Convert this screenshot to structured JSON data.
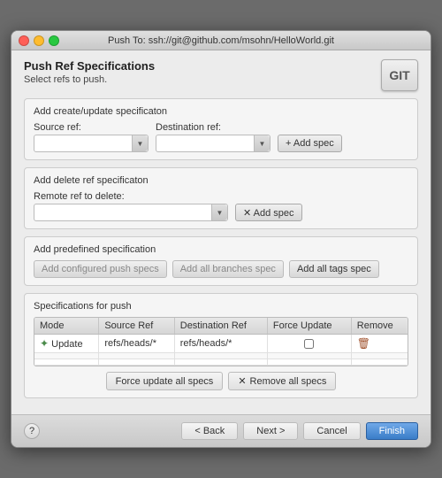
{
  "window": {
    "title": "Push To: ssh://git@github.com/msohn/HelloWorld.git"
  },
  "header": {
    "title": "Push Ref Specifications",
    "subtitle": "Select refs to push.",
    "git_label": "GIT"
  },
  "create_update_section": {
    "title": "Add create/update specificaton",
    "source_label": "Source ref:",
    "destination_label": "Destination ref:",
    "add_btn": "+ Add spec",
    "source_placeholder": "",
    "destination_placeholder": ""
  },
  "delete_section": {
    "title": "Add delete ref specificaton",
    "remote_label": "Remote ref to delete:",
    "add_btn": "✕ Add spec",
    "placeholder": ""
  },
  "predefined_section": {
    "title": "Add predefined specification",
    "btn1": "Add configured push specs",
    "btn2": "Add all branches spec",
    "btn3": "Add all tags spec"
  },
  "specs_section": {
    "title": "Specifications for push",
    "columns": [
      "Mode",
      "Source Ref",
      "Destination Ref",
      "Force Update",
      "Remove"
    ],
    "rows": [
      {
        "mode_icon": "✦",
        "mode": "Update",
        "source": "refs/heads/*",
        "destination": "refs/heads/*",
        "force_update": false,
        "remove": true
      }
    ],
    "force_update_btn": "Force update all specs",
    "remove_all_btn": "Remove all specs"
  },
  "footer": {
    "help_label": "?",
    "back_btn": "< Back",
    "next_btn": "Next >",
    "cancel_btn": "Cancel",
    "finish_btn": "Finish"
  }
}
